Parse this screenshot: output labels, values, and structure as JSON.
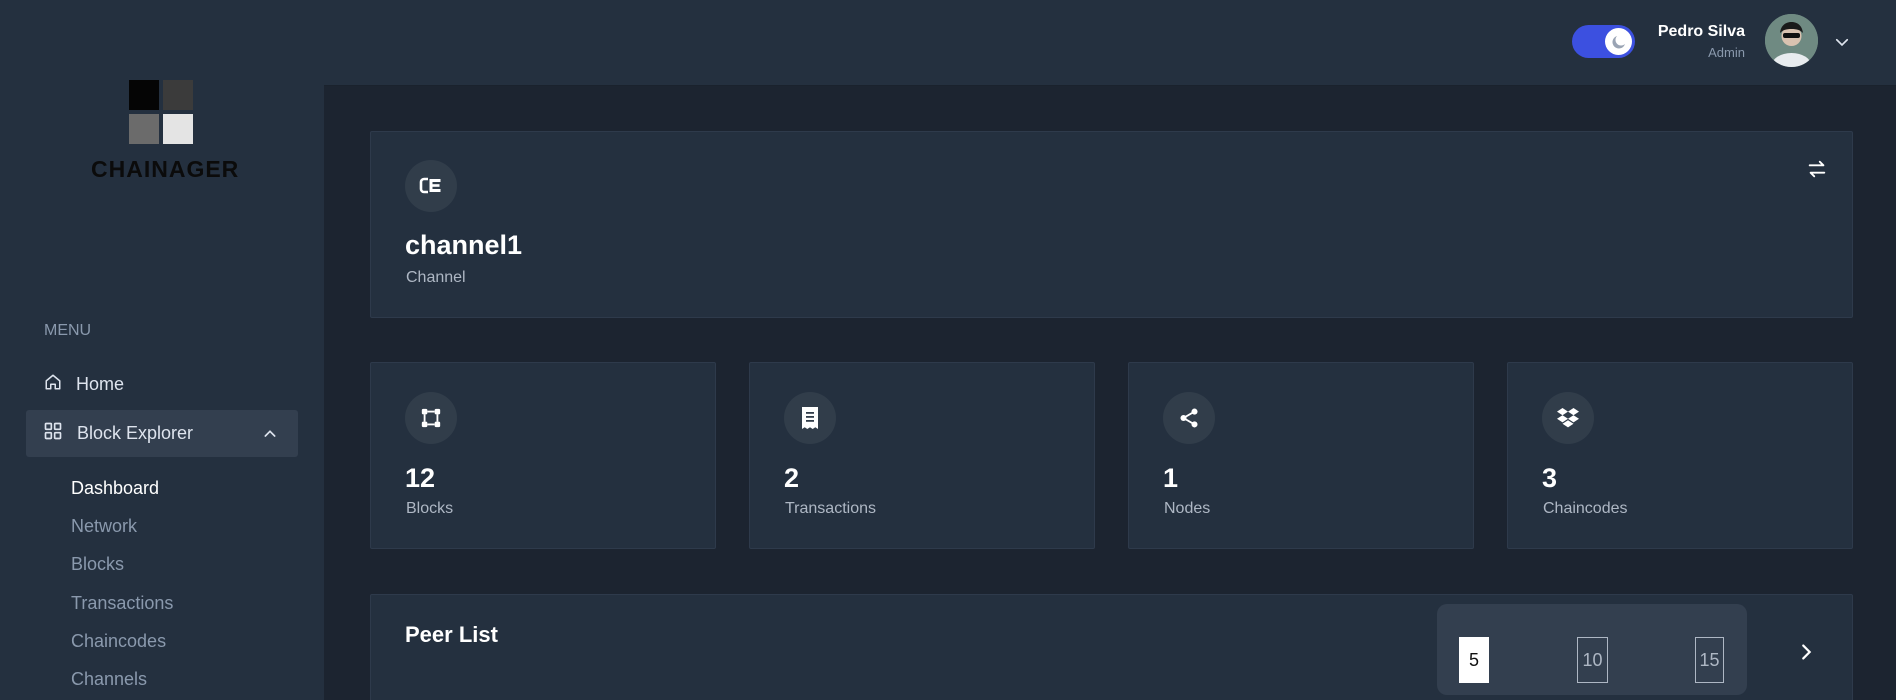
{
  "brand": {
    "name": "CHAINAGER"
  },
  "sidebar": {
    "menu_heading": "MENU",
    "home_label": "Home",
    "block_explorer_label": "Block Explorer",
    "submenu": [
      {
        "label": "Dashboard",
        "active": true
      },
      {
        "label": "Network",
        "active": false
      },
      {
        "label": "Blocks",
        "active": false
      },
      {
        "label": "Transactions",
        "active": false
      },
      {
        "label": "Chaincodes",
        "active": false
      },
      {
        "label": "Channels",
        "active": false
      }
    ]
  },
  "header": {
    "dark_mode": true,
    "user_name": "Pedro Silva",
    "user_role": "Admin"
  },
  "channel": {
    "name": "channel1",
    "label": "Channel"
  },
  "stats": [
    {
      "value": "12",
      "label": "Blocks",
      "icon": "blocks-icon"
    },
    {
      "value": "2",
      "label": "Transactions",
      "icon": "receipt-icon"
    },
    {
      "value": "1",
      "label": "Nodes",
      "icon": "share-icon"
    },
    {
      "value": "3",
      "label": "Chaincodes",
      "icon": "dropbox-icon"
    }
  ],
  "peer_list": {
    "title": "Peer List",
    "page_sizes": [
      "5",
      "10",
      "15"
    ],
    "selected_page_size": "5"
  },
  "colors": {
    "accent": "#3c50e0",
    "sidebar_bg": "#24303f",
    "page_bg": "#1c2430",
    "muted_text": "#8a99ad"
  }
}
